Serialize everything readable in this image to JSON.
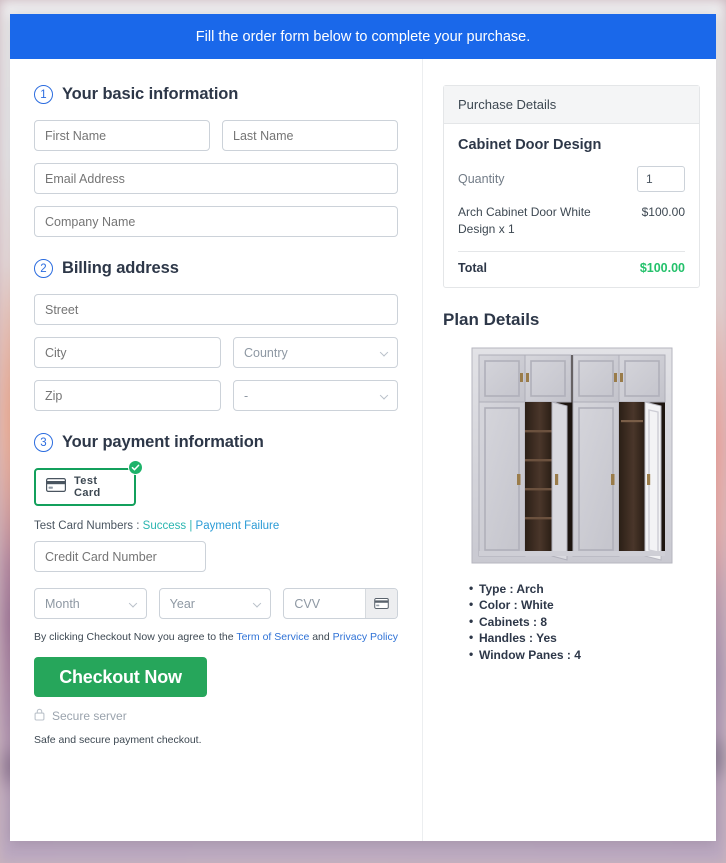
{
  "banner": {
    "text": "Fill the order form below to complete your purchase."
  },
  "sections": {
    "basic": {
      "num": "1",
      "title": "Your basic information"
    },
    "billing": {
      "num": "2",
      "title": "Billing address"
    },
    "payment": {
      "num": "3",
      "title": "Your payment information"
    }
  },
  "fields": {
    "first_name": "First Name",
    "last_name": "Last Name",
    "email": "Email Address",
    "company": "Company Name",
    "street": "Street",
    "city": "City",
    "country": "Country",
    "zip": "Zip",
    "state": "-",
    "credit_card": "Credit Card Number",
    "month": "Month",
    "year": "Year",
    "cvv": "CVV"
  },
  "payment": {
    "card_option_label": "Test Card",
    "card_icon": "credit-card-icon",
    "selected_badge_icon": "check-circle-icon",
    "test_numbers_prefix": "Test Card Numbers :",
    "link_success": "Success",
    "link_separator": "|",
    "link_failure": "Payment Failure",
    "cvv_hint_icon": "credit-card-back-icon"
  },
  "terms": {
    "prefix": "By clicking Checkout Now you agree to the",
    "link1": "Term of Service",
    "middle": "and",
    "link2": "Privacy Policy"
  },
  "checkout": {
    "button_label": "Checkout Now",
    "secure_icon": "lock-icon",
    "secure_label": "Secure server",
    "note": "Safe and secure payment checkout."
  },
  "purchase": {
    "header": "Purchase Details",
    "product_title": "Cabinet Door Design",
    "quantity_label": "Quantity",
    "quantity_value": "1",
    "line_item_desc": "Arch Cabinet Door White Design x 1",
    "line_item_amount": "$100.00",
    "total_label": "Total",
    "total_amount": "$100.00"
  },
  "plan": {
    "title": "Plan Details",
    "image_alt": "cabinet-door-preview-image",
    "specs": [
      "Type : Arch",
      "Color : White",
      "Cabinets : 8",
      "Handles : Yes",
      "Window Panes : 4"
    ]
  },
  "colors": {
    "banner_blue": "#1a68ea",
    "accent_blue": "#2b6cdf",
    "checkout_green": "#26a65b",
    "total_green": "#24c16b",
    "card_border_green": "#13a05c",
    "link_teal": "#2ab5b0"
  }
}
